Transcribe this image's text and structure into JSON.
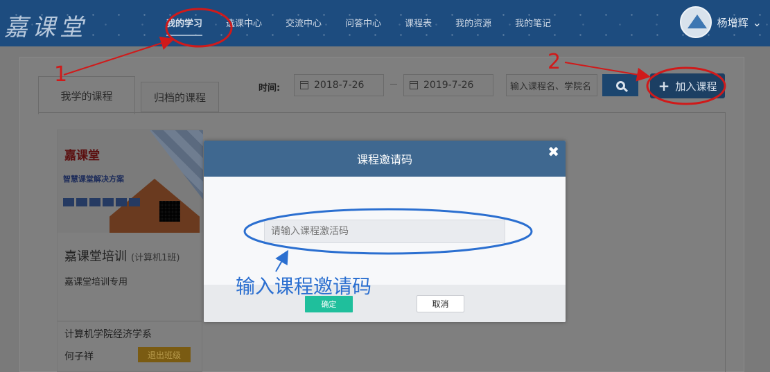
{
  "header": {
    "logo": "嘉课堂",
    "nav": [
      {
        "label": "我的学习",
        "active": true
      },
      {
        "label": "选课中心"
      },
      {
        "label": "交流中心"
      },
      {
        "label": "问答中心"
      },
      {
        "label": "课程表"
      },
      {
        "label": "我的资源"
      },
      {
        "label": "我的笔记"
      }
    ],
    "user_name": "杨增辉"
  },
  "tabs": [
    {
      "label": "我学的课程",
      "active": true
    },
    {
      "label": "归档的课程"
    }
  ],
  "filter": {
    "time_label": "时间:",
    "start_date": "2018-7-26",
    "end_date": "2019-7-26",
    "search_placeholder": "输入课程名、学院名",
    "join_label": "加入课程"
  },
  "course": {
    "thumb_brand": "嘉课堂",
    "thumb_slogan": "智慧课堂解决方案",
    "title": "嘉课堂培训",
    "class_name": "(计算机1班)",
    "description": "嘉课堂培训专用",
    "department": "计算机学院经济学系",
    "teacher": "何子祥",
    "quit_label": "退出班级"
  },
  "modal": {
    "title": "课程邀请码",
    "input_placeholder": "请输入课程激活码",
    "ok_label": "确定",
    "cancel_label": "取消"
  },
  "annotations": {
    "step1": "1",
    "step2": "2",
    "hint": "输入课程邀请码",
    "colors": {
      "red": "#d01a1a",
      "blue": "#2b6fd0"
    }
  },
  "colors": {
    "header_bg": "#1d4c7f",
    "modal_header": "#3f6890",
    "ok_button": "#1fbf9c"
  }
}
